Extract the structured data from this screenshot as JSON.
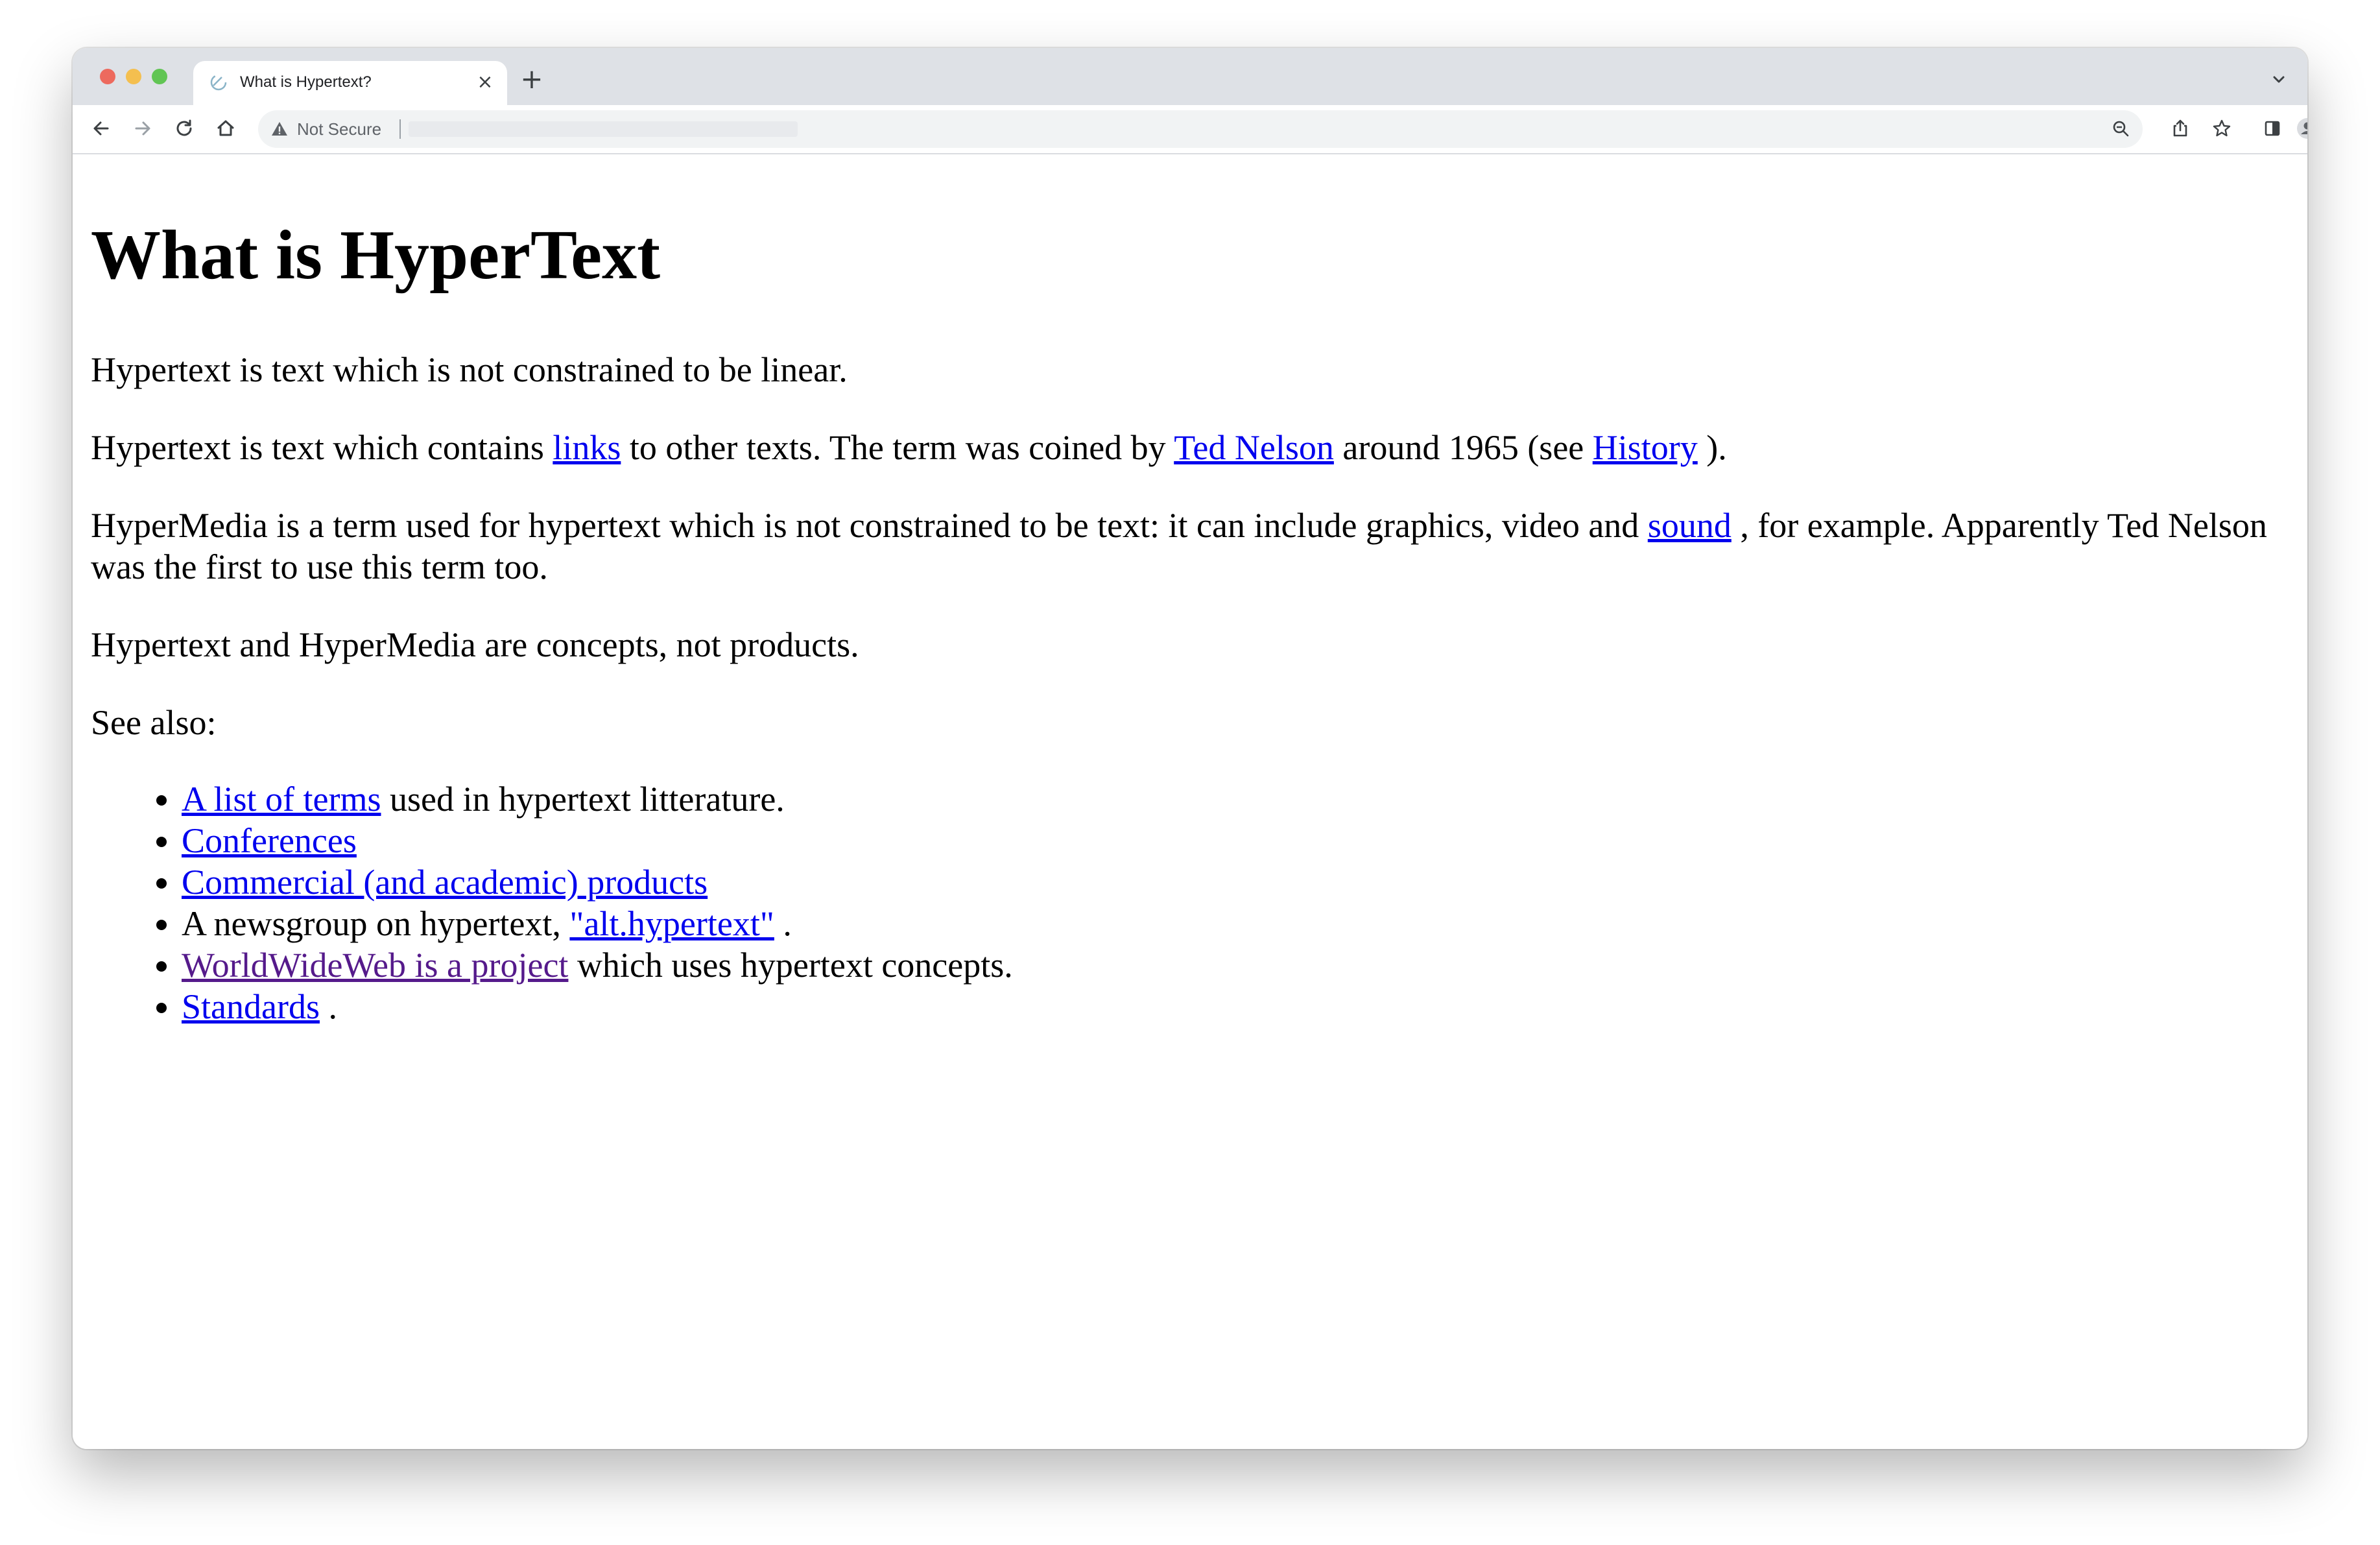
{
  "browser": {
    "tab": {
      "title": "What is Hypertext?",
      "close_glyph": "×"
    },
    "new_tab_glyph": "+",
    "address_bar": {
      "security_label": "Not Secure",
      "url": ""
    }
  },
  "page": {
    "heading": "What is HyperText",
    "p1": {
      "text": "Hypertext is text which is not constrained to be linear."
    },
    "p2": {
      "t1": "Hypertext is text which contains ",
      "link1": "links",
      "t2": " to other texts. The term was coined by ",
      "link2": "Ted Nelson",
      "t3": " around 1965 (see ",
      "link3": "History",
      "t4": " )."
    },
    "p3": {
      "t1": "HyperMedia is a term used for hypertext which is not constrained to be text: it can include graphics, video and ",
      "link1": "sound",
      "t2": " , for example. Apparently Ted Nelson was the first to use this term too."
    },
    "p4": {
      "text": "Hypertext and HyperMedia are concepts, not products."
    },
    "p5": {
      "text": "See also:"
    },
    "see_also": [
      {
        "link": "A list of terms",
        "after": " used in hypertext litterature."
      },
      {
        "link": "Conferences",
        "after": ""
      },
      {
        "link": "Commercial (and academic) products",
        "after": ""
      },
      {
        "before": "A newsgroup on hypertext, ",
        "link": "\"alt.hypertext\"",
        "after": " ."
      },
      {
        "link": "WorldWideWeb is a project",
        "after": " which uses hypertext concepts.",
        "visited": true
      },
      {
        "link": "Standards",
        "after": " ."
      }
    ]
  },
  "colors": {
    "link": "#0000ee",
    "visited_link": "#551a8b",
    "tabstrip": "#dee1e6",
    "omnibox": "#f1f3f4"
  }
}
